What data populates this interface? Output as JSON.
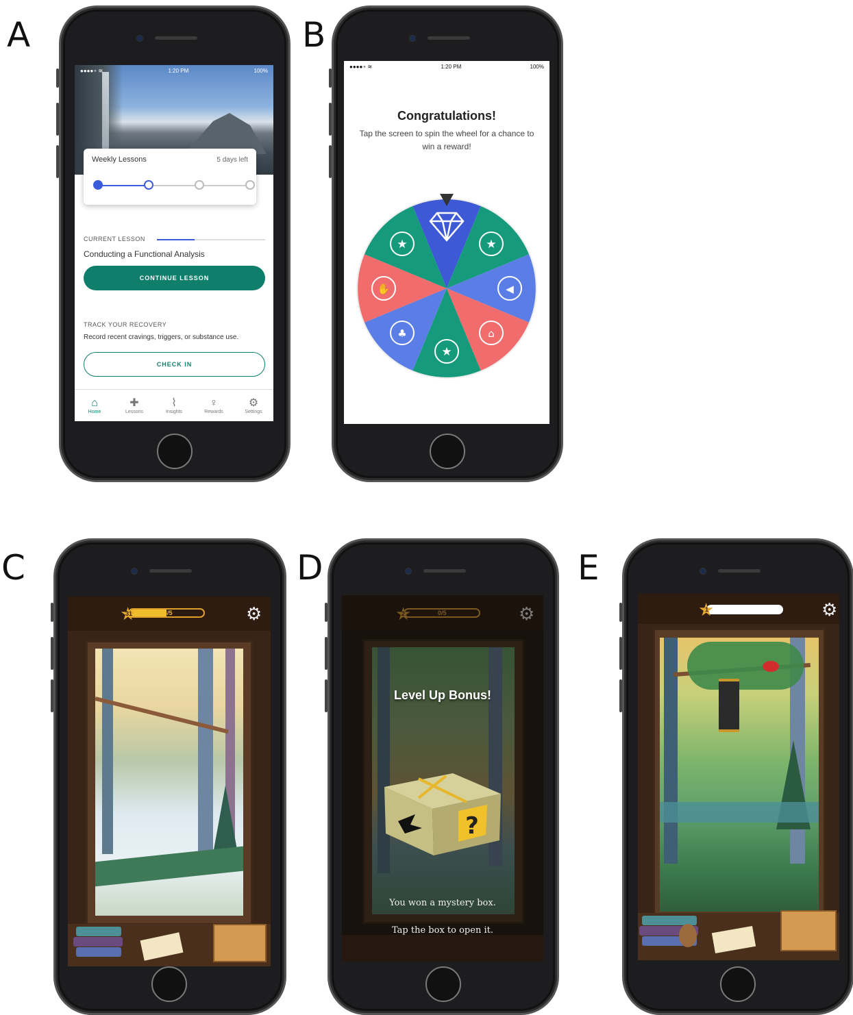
{
  "panels": [
    "A",
    "B",
    "C",
    "D",
    "E"
  ],
  "screen_a": {
    "status_time": "1:20 PM",
    "status_battery": "100%",
    "weekly_title": "Weekly Lessons",
    "days_left": "5 days left",
    "weekly_progress_completed": 2,
    "weekly_progress_total": 4,
    "current_lesson_label": "CURRENT LESSON",
    "current_lesson_progress": 0.35,
    "lesson_name": "Conducting a Functional Analysis",
    "continue_button": "CONTINUE LESSON",
    "track_label": "TRACK YOUR RECOVERY",
    "track_desc": "Record recent cravings, triggers, or substance use.",
    "checkin_button": "CHECK IN",
    "tabs": [
      {
        "label": "Home",
        "icon": "home-icon",
        "active": true
      },
      {
        "label": "Lessons",
        "icon": "cross-icon",
        "active": false
      },
      {
        "label": "Insights",
        "icon": "chart-icon",
        "active": false
      },
      {
        "label": "Rewards",
        "icon": "lightbulb-icon",
        "active": false
      },
      {
        "label": "Settings",
        "icon": "gear-icon",
        "active": false
      }
    ]
  },
  "screen_b": {
    "status_time": "1:20 PM",
    "status_battery": "100%",
    "title": "Congratulations!",
    "subtitle": "Tap the screen to spin the wheel for a chance to win a reward!",
    "wheel_colors": {
      "green": "#169a7c",
      "blue": "#5b7ee6",
      "red": "#f16d6d",
      "indigo": "#3e59d6"
    }
  },
  "screen_c": {
    "level": "31",
    "xp": "4/5",
    "xp_fraction": 0.6
  },
  "screen_d": {
    "level": "2",
    "xp": "0/5",
    "title": "Level Up Bonus!",
    "message1": "You won a mystery box.",
    "message2": "Tap the box to open it."
  },
  "screen_e": {
    "level": "1",
    "xp_fraction": 1.0
  }
}
